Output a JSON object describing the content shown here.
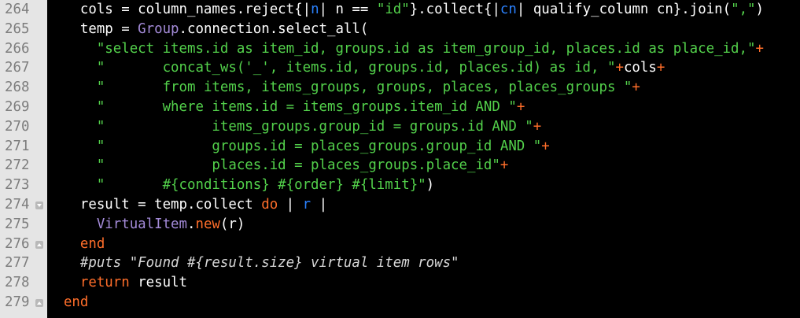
{
  "colors": {
    "background": "#000000",
    "gutter_bg": "#e5e5e5",
    "line_number": "#7d7d7d",
    "keyword": "#ff6e2a",
    "string": "#53d14b",
    "constant": "#a48bd9",
    "block_var": "#2b82ff",
    "comment": "#d7d7d7",
    "plain": "#ffffff"
  },
  "gutter": {
    "fold_icon": "fold-triangle-icon",
    "lines": [
      {
        "num": "264",
        "fold": ""
      },
      {
        "num": "265",
        "fold": ""
      },
      {
        "num": "266",
        "fold": ""
      },
      {
        "num": "267",
        "fold": ""
      },
      {
        "num": "268",
        "fold": ""
      },
      {
        "num": "269",
        "fold": ""
      },
      {
        "num": "270",
        "fold": ""
      },
      {
        "num": "271",
        "fold": ""
      },
      {
        "num": "272",
        "fold": ""
      },
      {
        "num": "273",
        "fold": ""
      },
      {
        "num": "274",
        "fold": "down"
      },
      {
        "num": "275",
        "fold": ""
      },
      {
        "num": "276",
        "fold": "up"
      },
      {
        "num": "277",
        "fold": ""
      },
      {
        "num": "278",
        "fold": ""
      },
      {
        "num": "279",
        "fold": "up"
      }
    ]
  },
  "code": {
    "lines": [
      [
        {
          "t": "    cols = column_names.reject{",
          "c": "plain"
        },
        {
          "t": "|",
          "c": "plain"
        },
        {
          "t": "n",
          "c": "var"
        },
        {
          "t": "| n == ",
          "c": "plain"
        },
        {
          "t": "\"id\"",
          "c": "str"
        },
        {
          "t": "}.collect{",
          "c": "plain"
        },
        {
          "t": "|",
          "c": "plain"
        },
        {
          "t": "cn",
          "c": "var"
        },
        {
          "t": "| qualify_column cn}.join(",
          "c": "plain"
        },
        {
          "t": "\",\"",
          "c": "str"
        },
        {
          "t": ")",
          "c": "plain"
        }
      ],
      [
        {
          "t": "    temp = ",
          "c": "plain"
        },
        {
          "t": "Group",
          "c": "const"
        },
        {
          "t": ".connection.select_all(",
          "c": "plain"
        }
      ],
      [
        {
          "t": "      ",
          "c": "plain"
        },
        {
          "t": "\"select items.id as item_id, groups.id as item_group_id, places.id as place_id,\"",
          "c": "str"
        },
        {
          "t": "+",
          "c": "kw"
        }
      ],
      [
        {
          "t": "      ",
          "c": "plain"
        },
        {
          "t": "\"       concat_ws('_', items.id, groups.id, places.id) as id, \"",
          "c": "str"
        },
        {
          "t": "+",
          "c": "kw"
        },
        {
          "t": "cols",
          "c": "plain"
        },
        {
          "t": "+",
          "c": "kw"
        }
      ],
      [
        {
          "t": "      ",
          "c": "plain"
        },
        {
          "t": "\"       from items, items_groups, groups, places, places_groups \"",
          "c": "str"
        },
        {
          "t": "+",
          "c": "kw"
        }
      ],
      [
        {
          "t": "      ",
          "c": "plain"
        },
        {
          "t": "\"       where items.id = items_groups.item_id AND \"",
          "c": "str"
        },
        {
          "t": "+",
          "c": "kw"
        }
      ],
      [
        {
          "t": "      ",
          "c": "plain"
        },
        {
          "t": "\"             items_groups.group_id = groups.id AND \"",
          "c": "str"
        },
        {
          "t": "+",
          "c": "kw"
        }
      ],
      [
        {
          "t": "      ",
          "c": "plain"
        },
        {
          "t": "\"             groups.id = places_groups.group_id AND \"",
          "c": "str"
        },
        {
          "t": "+",
          "c": "kw"
        }
      ],
      [
        {
          "t": "      ",
          "c": "plain"
        },
        {
          "t": "\"             places.id = places_groups.place_id\"",
          "c": "str"
        },
        {
          "t": "+",
          "c": "kw"
        }
      ],
      [
        {
          "t": "      ",
          "c": "plain"
        },
        {
          "t": "\"       #{conditions} #{order} #{limit}\"",
          "c": "str"
        },
        {
          "t": ")",
          "c": "plain"
        }
      ],
      [
        {
          "t": "    result = temp.collect ",
          "c": "plain"
        },
        {
          "t": "do",
          "c": "kw"
        },
        {
          "t": " | ",
          "c": "plain"
        },
        {
          "t": "r",
          "c": "var"
        },
        {
          "t": " |",
          "c": "plain"
        }
      ],
      [
        {
          "t": "      ",
          "c": "plain"
        },
        {
          "t": "VirtualItem",
          "c": "const"
        },
        {
          "t": ".",
          "c": "plain"
        },
        {
          "t": "new",
          "c": "kw"
        },
        {
          "t": "(r)",
          "c": "plain"
        }
      ],
      [
        {
          "t": "    ",
          "c": "plain"
        },
        {
          "t": "end",
          "c": "kw"
        }
      ],
      [
        {
          "t": "    ",
          "c": "plain"
        },
        {
          "t": "#puts \"Found #{result.size} virtual item rows\"",
          "c": "cm"
        }
      ],
      [
        {
          "t": "    ",
          "c": "plain"
        },
        {
          "t": "return",
          "c": "kw"
        },
        {
          "t": " result",
          "c": "plain"
        }
      ],
      [
        {
          "t": "  ",
          "c": "plain"
        },
        {
          "t": "end",
          "c": "kw"
        }
      ]
    ]
  }
}
